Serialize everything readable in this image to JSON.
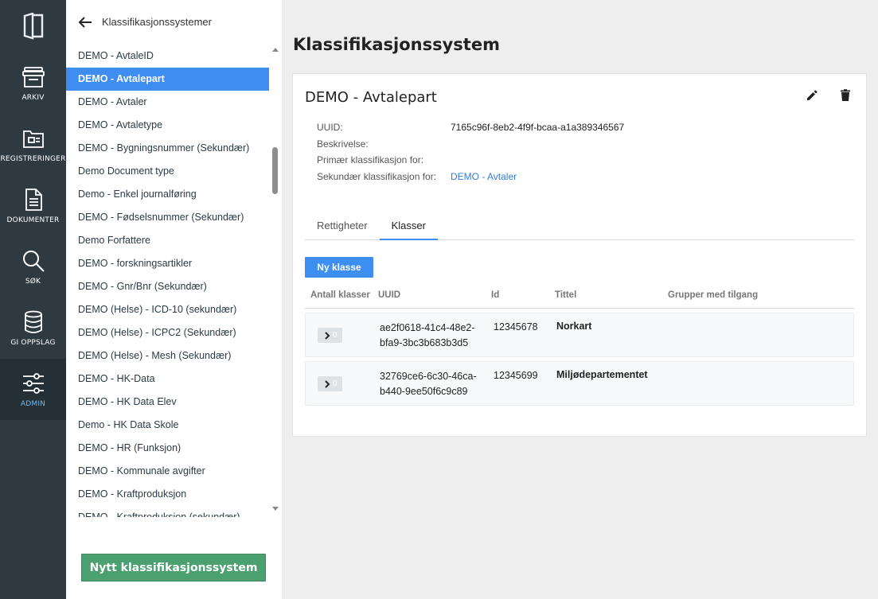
{
  "nav": {
    "items": [
      {
        "id": "arkiv",
        "label": "ARKIV",
        "icon": "archive-box-icon"
      },
      {
        "id": "registreringer",
        "label": "REGISTRERINGER",
        "icon": "folder-icon"
      },
      {
        "id": "dokumenter",
        "label": "DOKUMENTER",
        "icon": "document-icon"
      },
      {
        "id": "sok",
        "label": "SØK",
        "icon": "search-icon"
      },
      {
        "id": "oppslag",
        "label": "GI OPPSLAG",
        "icon": "database-icon"
      },
      {
        "id": "admin",
        "label": "ADMIN",
        "icon": "sliders-icon",
        "active": true
      }
    ],
    "active_color": "#6cb8f0"
  },
  "sidebar": {
    "back_label": "Klassifikasjonssystemer",
    "items": [
      "DEMO - AvtaleID",
      "DEMO - Avtalepart",
      "DEMO - Avtaler",
      "DEMO - Avtaletype",
      "DEMO - Bygningsnummer (Sekundær)",
      "Demo Document type",
      "Demo - Enkel journalføring",
      "DEMO - Fødselsnummer (Sekundær)",
      "Demo Forfattere",
      "DEMO - forskningsartikler",
      "DEMO - Gnr/Bnr (Sekundær)",
      "DEMO (Helse) - ICD-10 (sekundær)",
      "DEMO (Helse) - ICPC2 (Sekundær)",
      "DEMO (Helse) - Mesh (Sekundær)",
      "DEMO - HK-Data",
      "DEMO - HK Data Elev",
      "Demo - HK Data Skole",
      "DEMO - HR (Funksjon)",
      "DEMO - Kommunale avgifter",
      "DEMO - Kraftproduksjon",
      "DEMO - Kraftproduksjon (sekundær)"
    ],
    "selected_index": 1,
    "new_button_label": "Nytt klassifikasjonssystem",
    "new_button_color": "#4aa06f",
    "selected_color": "#3d8ef0"
  },
  "main": {
    "page_title": "Klassifikasjonssystem",
    "card": {
      "title": "DEMO - Avtalepart",
      "meta": {
        "uuid_label": "UUID:",
        "uuid_value": "7165c96f-8eb2-4f9f-bcaa-a1a389346567",
        "description_label": "Beskrivelse:",
        "description_value": "",
        "primary_label": "Primær klassifikasjon for:",
        "primary_value": "",
        "secondary_label": "Sekundær klassifikasjon for:",
        "secondary_value": "DEMO - Avtaler"
      },
      "tabs": [
        "Rettigheter",
        "Klasser"
      ],
      "active_tab": 1,
      "new_class_label": "Ny klasse",
      "table": {
        "headers": [
          "Antall klasser",
          "UUID",
          "Id",
          "Tittel",
          "Grupper med tilgang"
        ],
        "rows": [
          {
            "count": "0",
            "uuid_line1": "ae2f0618-41c4-48e2-",
            "uuid_line2": "bfa9-3bc3b683b3d5",
            "id": "12345678",
            "title": "Norkart"
          },
          {
            "count": "0",
            "uuid_line1": "32769ce6-6c30-46ca-",
            "uuid_line2": "b440-9ee50f6c9c89",
            "id": "12345699",
            "title": "Miljødepartementet"
          }
        ]
      }
    }
  }
}
